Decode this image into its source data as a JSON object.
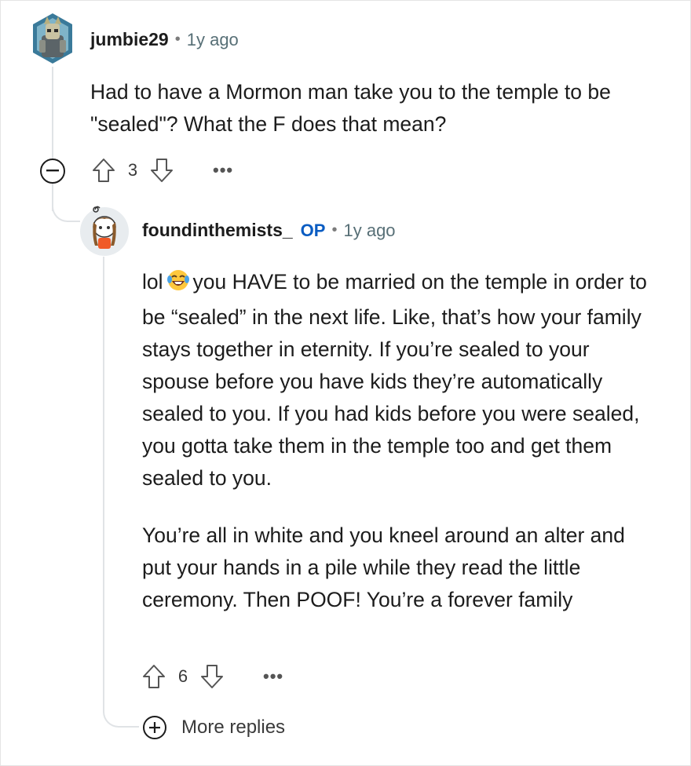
{
  "comment1": {
    "username": "jumbie29",
    "separator": "•",
    "time": "1y ago",
    "text": "Had to have a Mormon man take you to the temple to be \"sealed\"? What the F does that mean?",
    "votes": "3",
    "more": "•••",
    "collapse_icon": "minus-circle-icon"
  },
  "comment2": {
    "username": "foundinthemists_",
    "op_badge": "OP",
    "separator": "•",
    "time": "1y ago",
    "text_prefix": "lol",
    "emoji": "laughing-tears-emoji",
    "text_rest": "you HAVE to be married on the temple in order to be “sealed” in the next life. Like, that’s how your family stays together in eternity. If you’re sealed to your spouse before you have kids they’re automatically sealed to you. If you had kids before you were sealed, you gotta take them in the temple too and get them sealed to you.",
    "text_p2": "You’re all in white and you kneel around an alter and put your hands in a pile while they read the little ceremony. Then POOF! You’re a forever family",
    "votes": "6",
    "more": "•••"
  },
  "more_replies": {
    "label": "More replies",
    "icon": "plus-circle-icon"
  }
}
